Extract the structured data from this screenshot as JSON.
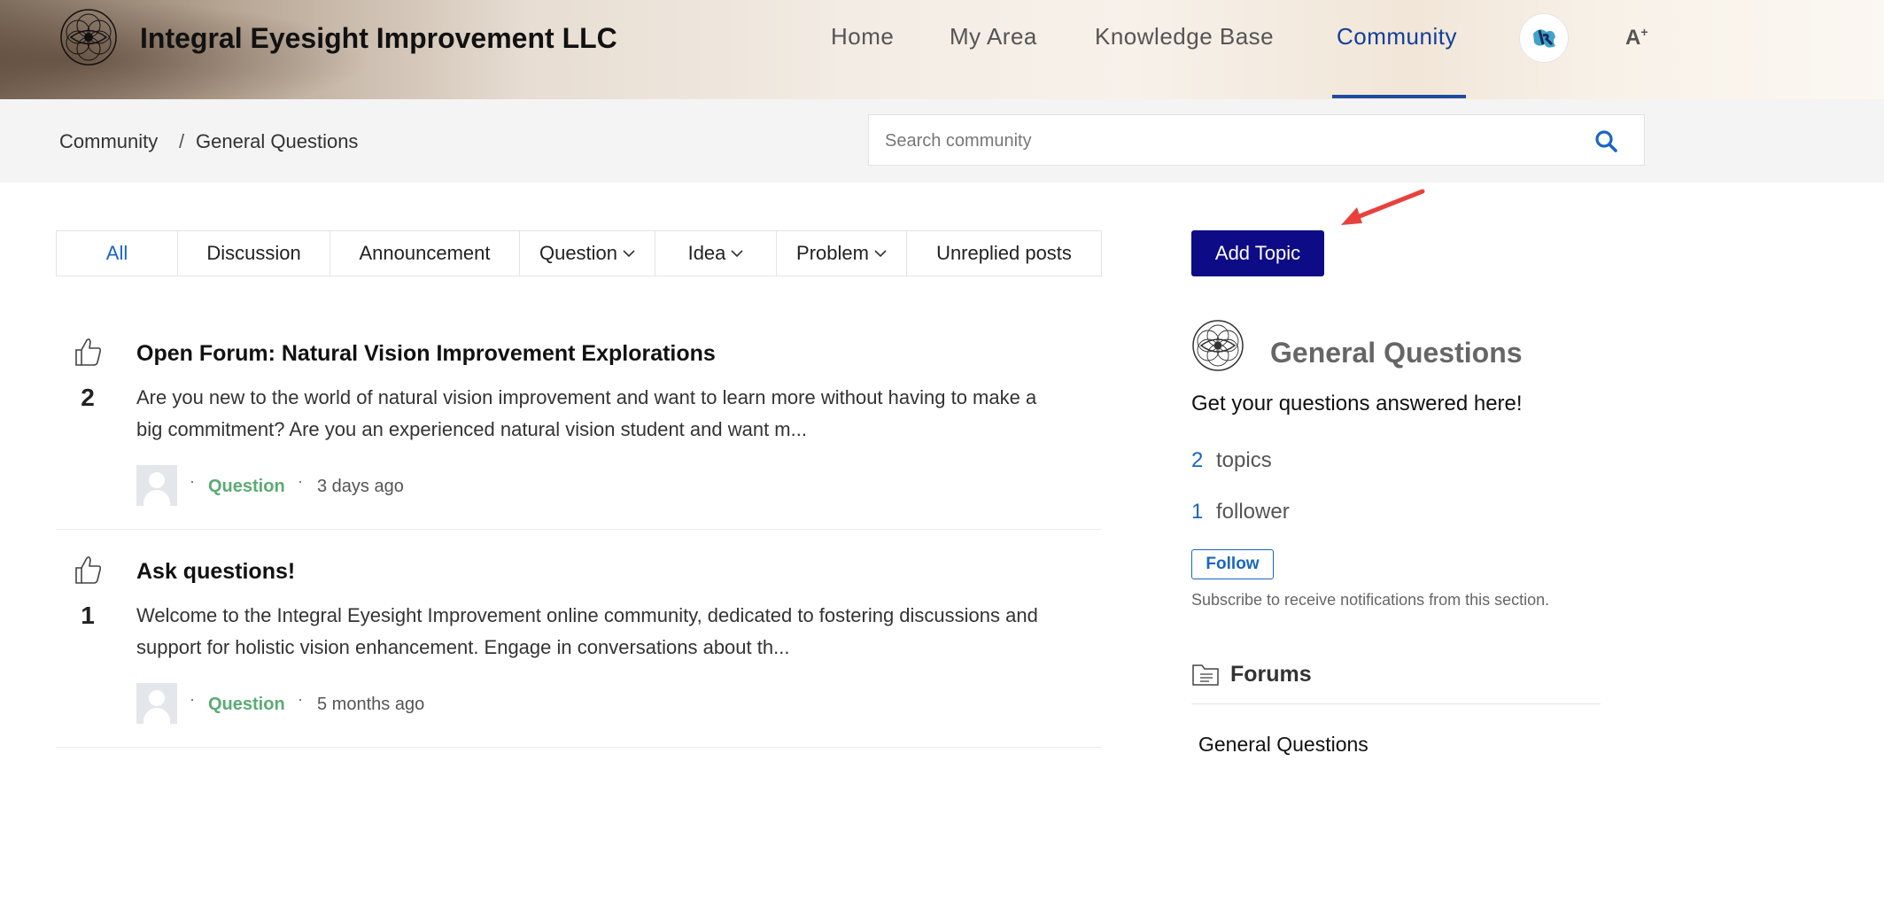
{
  "header": {
    "brand": "Integral Eyesight Improvement LLC",
    "nav": [
      {
        "label": "Home",
        "active": false
      },
      {
        "label": "My Area",
        "active": false
      },
      {
        "label": "Knowledge Base",
        "active": false
      },
      {
        "label": "Community",
        "active": true
      }
    ],
    "font_size_icon": "A",
    "font_size_sup": "+",
    "accent_color": "#1f4b9e"
  },
  "breadcrumb": {
    "items": [
      "Community",
      "General Questions"
    ],
    "separator": "/"
  },
  "search": {
    "placeholder": "Search community",
    "value": ""
  },
  "tabs": [
    {
      "label": "All",
      "active": true,
      "dropdown": false
    },
    {
      "label": "Discussion",
      "active": false,
      "dropdown": false
    },
    {
      "label": "Announcement",
      "active": false,
      "dropdown": false
    },
    {
      "label": "Question",
      "active": false,
      "dropdown": true
    },
    {
      "label": "Idea",
      "active": false,
      "dropdown": true
    },
    {
      "label": "Problem",
      "active": false,
      "dropdown": true
    },
    {
      "label": "Unreplied posts",
      "active": false,
      "dropdown": false
    }
  ],
  "posts": [
    {
      "votes": "2",
      "title": "Open Forum: Natural Vision Improvement Explorations",
      "body_line1": "Are you new to the world of natural vision improvement and want to learn more without having to make a",
      "body_line2": "big commitment? Are you an experienced natural vision student and want m...",
      "type": "Question",
      "time": "3 days ago"
    },
    {
      "votes": "1",
      "title": "Ask questions!",
      "body_line1": "Welcome to the Integral Eyesight Improvement online community, dedicated to fostering discussions and",
      "body_line2": "support for holistic vision enhancement. Engage in conversations about th...",
      "type": "Question",
      "time": "5 months ago"
    }
  ],
  "sidebar": {
    "add_topic_label": "Add Topic",
    "add_topic_color": "#0e0b86",
    "forum_name": "General Questions",
    "forum_desc": "Get your questions answered here!",
    "topics_count": "2",
    "topics_label": "topics",
    "followers_count": "1",
    "followers_label": "follower",
    "follow_label": "Follow",
    "follow_note": "Subscribe to receive notifications from this section.",
    "forums_heading": "Forums",
    "forums": [
      "General Questions"
    ]
  },
  "annotation": {
    "arrow_color": "#e8413d"
  }
}
